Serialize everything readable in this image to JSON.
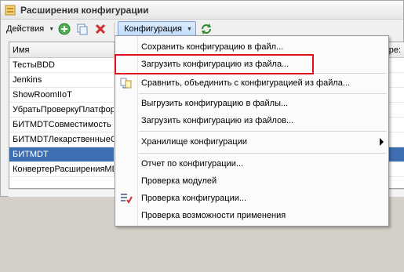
{
  "window": {
    "title": "Расширения конфигурации"
  },
  "toolbar": {
    "actions_label": "Действия",
    "config_label": "Конфигурация"
  },
  "grid": {
    "column_name": "Имя",
    "column_right": "ре:",
    "rows": [
      {
        "name": "ТестыBDD"
      },
      {
        "name": "Jenkins"
      },
      {
        "name": "ShowRoomIIoT"
      },
      {
        "name": "УбратьПроверкуПлатфор"
      },
      {
        "name": "БИТMDTСовместимость"
      },
      {
        "name": "БИТMDTЛекарственныеС"
      },
      {
        "name": "БИТMDT"
      },
      {
        "name": "КонвертерРасширенияMD"
      }
    ],
    "selected_index": 6
  },
  "menu": {
    "items": [
      {
        "label": "Сохранить конфигурацию в файл...",
        "icon": ""
      },
      {
        "label": "Загрузить конфигурацию из файла...",
        "icon": ""
      },
      {
        "label": "Сравнить, объединить с конфигурацией из файла...",
        "icon": "compare-merge-icon"
      },
      {
        "label": "Выгрузить конфигурацию в файлы...",
        "icon": ""
      },
      {
        "label": "Загрузить конфигурацию из файлов...",
        "icon": ""
      },
      {
        "label": "Хранилище конфигурации",
        "icon": "",
        "submenu": true
      },
      {
        "label": "Отчет по конфигурации...",
        "icon": ""
      },
      {
        "label": "Проверка модулей",
        "icon": ""
      },
      {
        "label": "Проверка конфигурации...",
        "icon": "check-config-icon"
      },
      {
        "label": "Проверка возможности применения",
        "icon": ""
      }
    ]
  },
  "colors": {
    "selection": "#3d6fb2",
    "highlight": "#e0101e"
  }
}
